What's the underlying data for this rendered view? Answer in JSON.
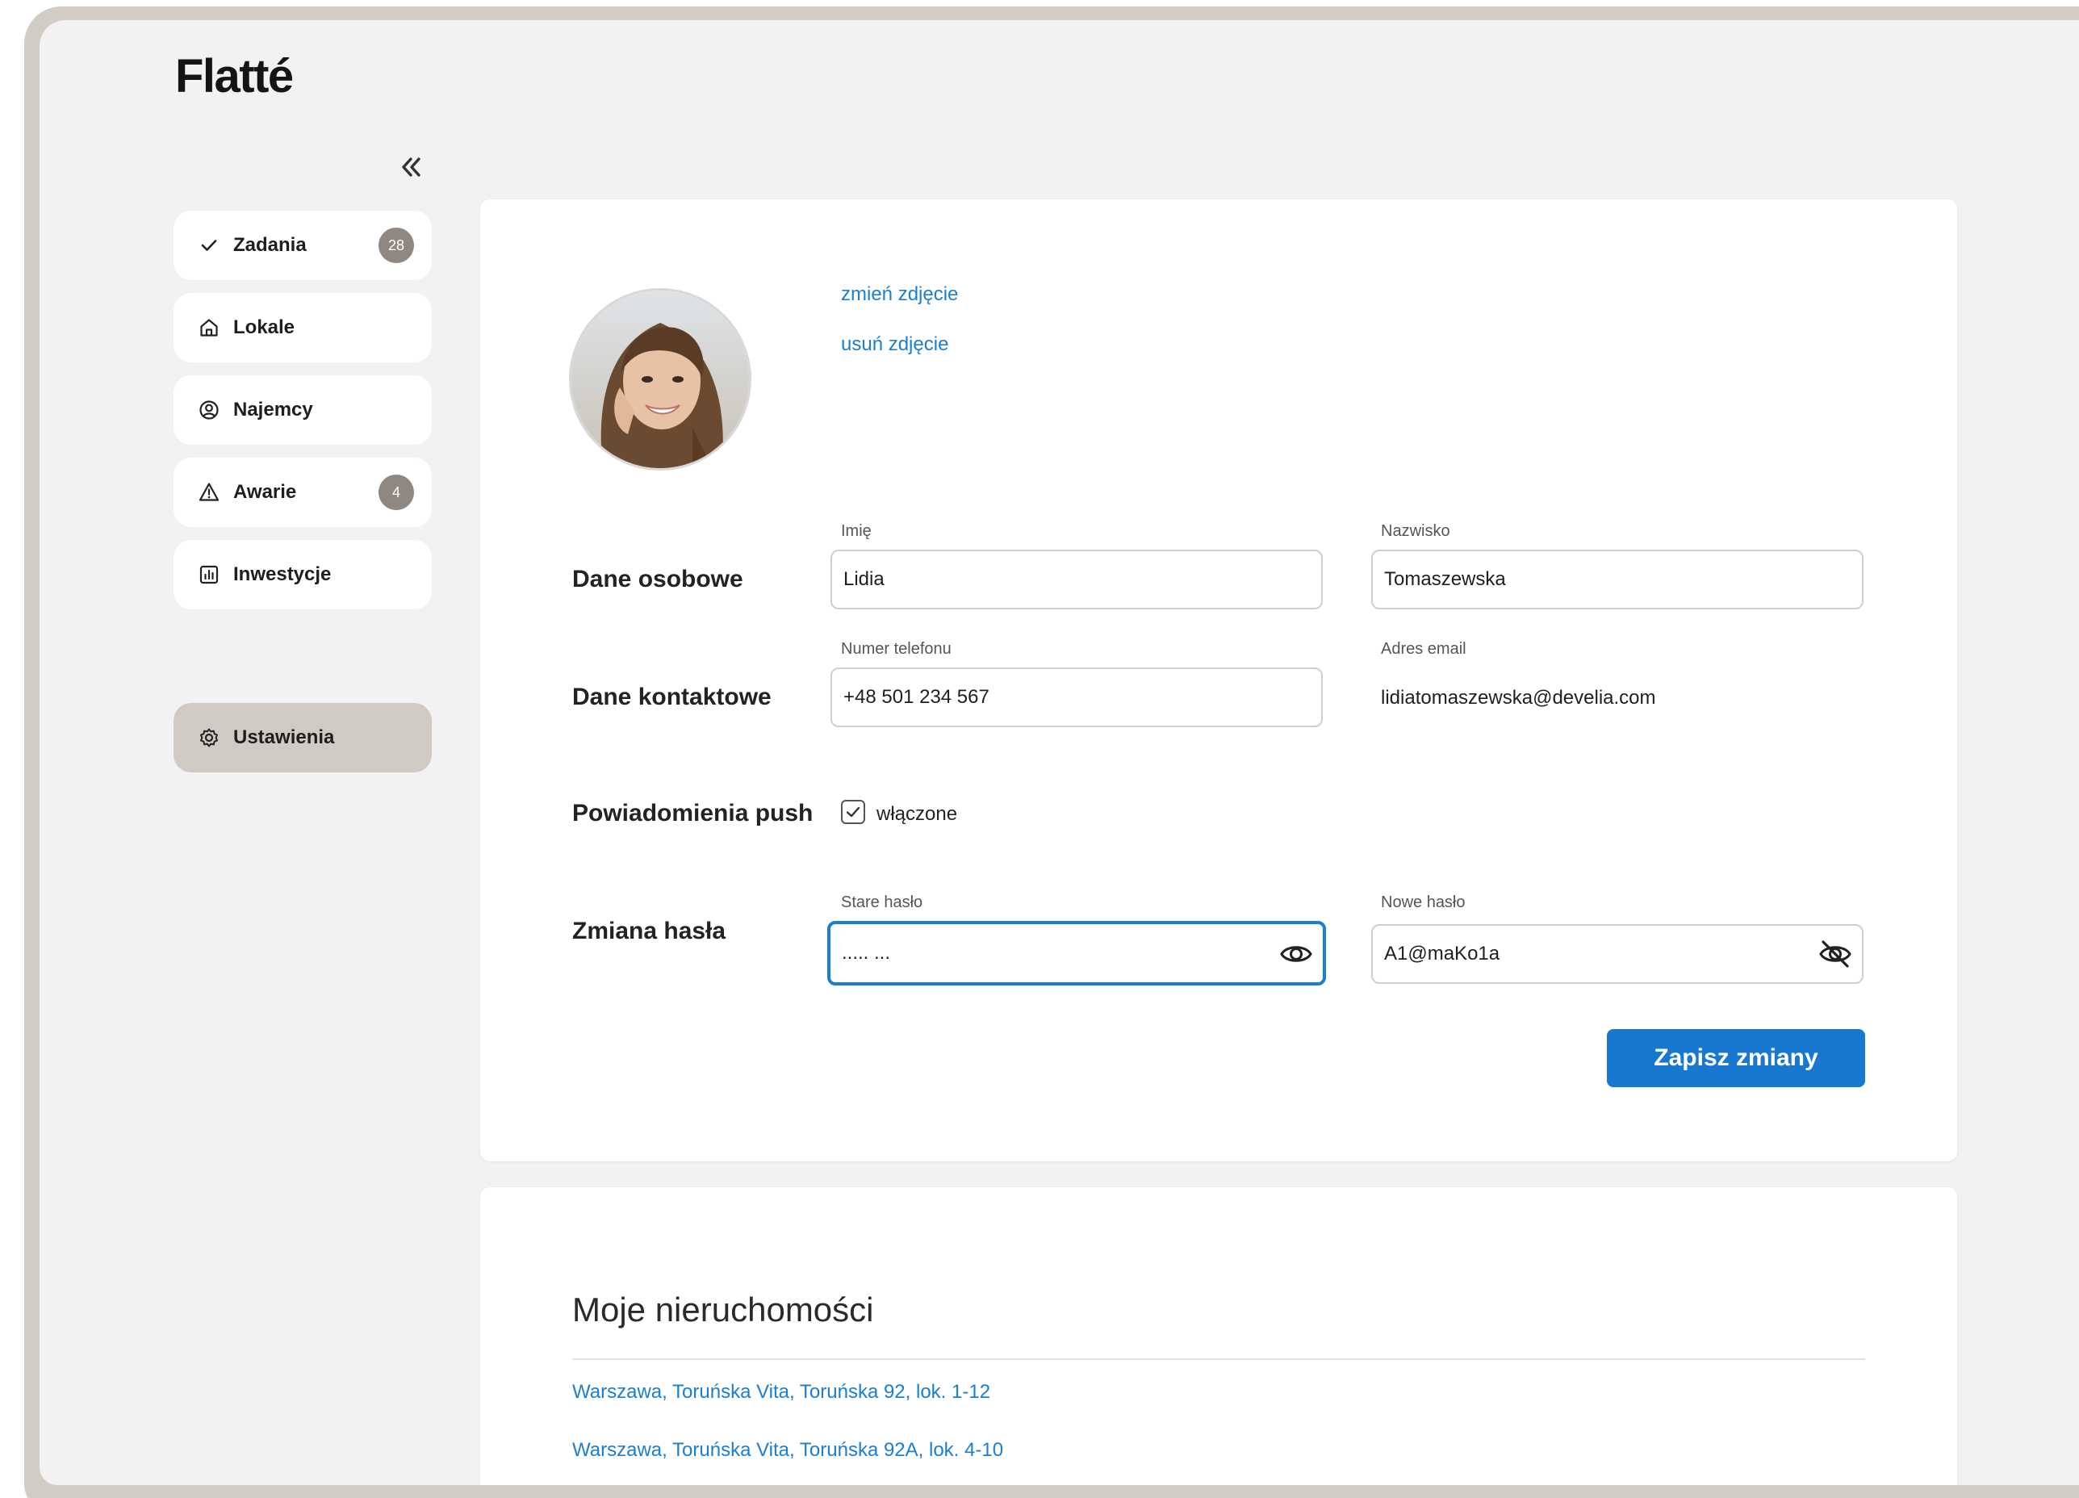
{
  "app": {
    "logo": "Flatté"
  },
  "sidebar": {
    "items": [
      {
        "label": "Zadania",
        "icon": "check-icon",
        "badge": "28"
      },
      {
        "label": "Lokale",
        "icon": "home-icon"
      },
      {
        "label": "Najemcy",
        "icon": "user-circle-icon"
      },
      {
        "label": "Awarie",
        "icon": "warning-icon",
        "badge": "4"
      },
      {
        "label": "Inwestycje",
        "icon": "bar-chart-icon"
      }
    ],
    "settings": {
      "label": "Ustawienia",
      "icon": "gear-icon",
      "active": true
    }
  },
  "profile": {
    "change_photo": "zmień zdjęcie",
    "remove_photo": "usuń zdjęcie",
    "personal": {
      "section": "Dane osobowe",
      "first_name_label": "Imię",
      "first_name": "Lidia",
      "last_name_label": "Nazwisko",
      "last_name": "Tomaszewska"
    },
    "contact": {
      "section": "Dane kontaktowe",
      "phone_label": "Numer telefonu",
      "phone": "+48 501 234 567",
      "email_label": "Adres email",
      "email": "lidiatomaszewska@develia.com"
    },
    "push": {
      "section": "Powiadomienia push",
      "checkbox_label": "włączone",
      "checked": true
    },
    "password": {
      "section": "Zmiana hasła",
      "old_label": "Stare hasło",
      "old_value": "..... ...",
      "new_label": "Nowe hasło",
      "new_value": "A1@maKo1a"
    },
    "save_label": "Zapisz zmiany"
  },
  "properties": {
    "title": "Moje nieruchomości",
    "items": [
      "Warszawa, Toruńska Vita, Toruńska 92, lok. 1-12",
      "Warszawa, Toruńska Vita, Toruńska 92A, lok. 4-10"
    ]
  },
  "colors": {
    "accent": "#1877cf",
    "link": "#1a7fd0",
    "sidebar_active": "#d0cac4",
    "badge": "#8f8781"
  }
}
